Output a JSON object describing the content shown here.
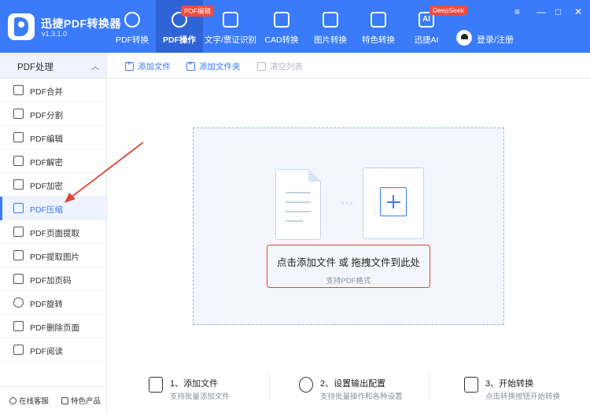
{
  "app": {
    "name": "迅捷PDF转换器",
    "version": "v1.3.1.0"
  },
  "nav": [
    {
      "label": "PDF转换",
      "icon": "convert-icon"
    },
    {
      "label": "PDF操作",
      "icon": "pdf-operation-icon",
      "active": true,
      "badge": "PDF编辑"
    },
    {
      "label": "文字/票证识别",
      "icon": "ocr-scan-icon"
    },
    {
      "label": "CAD转换",
      "icon": "cad-icon"
    },
    {
      "label": "图片转换",
      "icon": "image-icon"
    },
    {
      "label": "特色转换",
      "icon": "star-convert-icon"
    },
    {
      "label": "迅捷AI",
      "icon": "ai-icon",
      "badge": "DeepSeek"
    }
  ],
  "window": {
    "menu": "≡",
    "minimize": "—",
    "maximize": "□",
    "close": "✕"
  },
  "user": {
    "login": "登录/注册"
  },
  "sidebar": {
    "header": "PDF处理",
    "items": [
      {
        "label": "PDF合并"
      },
      {
        "label": "PDF分割"
      },
      {
        "label": "PDF编辑"
      },
      {
        "label": "PDF解密"
      },
      {
        "label": "PDF加密"
      },
      {
        "label": "PDF压缩",
        "active": true
      },
      {
        "label": "PDF页面提取"
      },
      {
        "label": "PDF提取图片"
      },
      {
        "label": "PDF加页码"
      },
      {
        "label": "PDF旋转"
      },
      {
        "label": "PDF删除页面"
      },
      {
        "label": "PDF阅读"
      }
    ],
    "footer": {
      "service": "在线客服",
      "products": "特色产品"
    }
  },
  "toolbar": {
    "add_file": "添加文件",
    "add_folder": "添加文件夹",
    "clear_list": "清空列表"
  },
  "dropzone": {
    "title": "点击添加文件 或 拖拽文件到此处",
    "subtitle": "支持PDF格式",
    "dots": "›››"
  },
  "steps": [
    {
      "title": "1、添加文件",
      "desc": "支持批量添加文件"
    },
    {
      "title": "2、设置输出配置",
      "desc": "支持批量操作和各种设置"
    },
    {
      "title": "3、开始转换",
      "desc": "点击转换按钮开始转换"
    }
  ],
  "colors": {
    "accent": "#3a7bfa",
    "highlight": "#e04533",
    "badge": "#f24b3e"
  }
}
